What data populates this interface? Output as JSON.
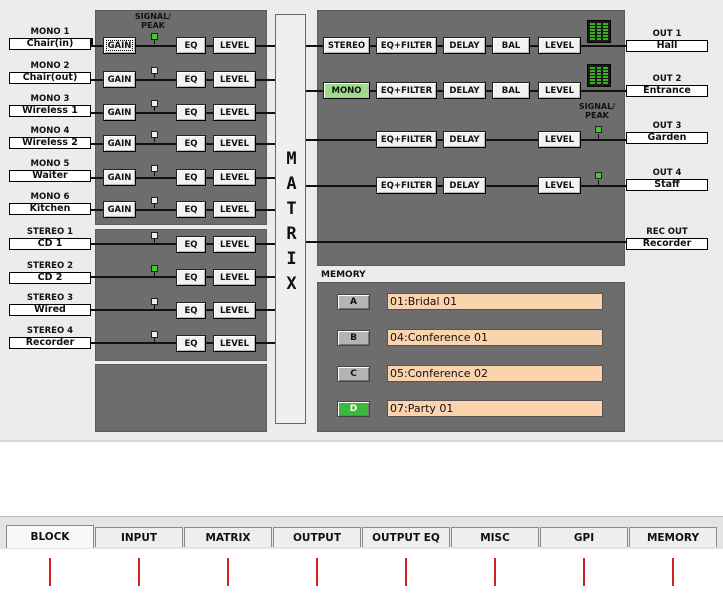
{
  "signal_peak_label": "SIGNAL/\nPEAK",
  "signal_peak_label_out": "SIGNAL/\nPEAK",
  "matrix_letters": [
    "M",
    "A",
    "T",
    "R",
    "I",
    "X"
  ],
  "inputs": {
    "mono": [
      {
        "label": "MONO 1",
        "name": "Chair(in)",
        "led_on": true
      },
      {
        "label": "MONO 2",
        "name": "Chair(out)",
        "led_on": false
      },
      {
        "label": "MONO 3",
        "name": "Wireless 1",
        "led_on": false
      },
      {
        "label": "MONO 4",
        "name": "Wireless 2",
        "led_on": false
      },
      {
        "label": "MONO 5",
        "name": "Waiter",
        "led_on": false
      },
      {
        "label": "MONO 6",
        "name": "Kitchen",
        "led_on": false
      }
    ],
    "stereo": [
      {
        "label": "STEREO 1",
        "name": "CD 1",
        "led_on": false
      },
      {
        "label": "STEREO 2",
        "name": "CD 2",
        "led_on": true
      },
      {
        "label": "STEREO 3",
        "name": "Wired",
        "led_on": false
      },
      {
        "label": "STEREO 4",
        "name": "Recorder",
        "led_on": false
      }
    ],
    "gain_label": "GAIN",
    "eq_label": "EQ",
    "level_label": "LEVEL"
  },
  "outputs": [
    {
      "label": "OUT 1",
      "name": "Hall",
      "mode": "STEREO"
    },
    {
      "label": "OUT 2",
      "name": "Entrance",
      "mode": "MONO"
    },
    {
      "label": "OUT 3",
      "name": "Garden"
    },
    {
      "label": "OUT 4",
      "name": "Staff"
    }
  ],
  "rec_out": {
    "label": "REC OUT",
    "name": "Recorder"
  },
  "output_buttons": {
    "eqfilter": "EQ+FILTER",
    "delay": "DELAY",
    "bal": "BAL",
    "level": "LEVEL"
  },
  "memory": {
    "title": "MEMORY",
    "slots": [
      {
        "key": "A",
        "name": "01:Bridal 01",
        "active": false
      },
      {
        "key": "B",
        "name": "04:Conference 01",
        "active": false
      },
      {
        "key": "C",
        "name": "05:Conference 02",
        "active": false
      },
      {
        "key": "D",
        "name": "07:Party 01",
        "active": true
      }
    ]
  },
  "tabs": [
    "BLOCK",
    "INPUT",
    "MATRIX",
    "OUTPUT",
    "OUTPUT EQ",
    "MISC",
    "GPI",
    "MEMORY"
  ],
  "active_tab": "BLOCK",
  "colors": {
    "panel": "#6d6d6d",
    "active_green": "#9fdb8b",
    "led_green": "#44c834",
    "memory_name_bg": "#fbd3ad",
    "callout_red": "#d42020"
  }
}
